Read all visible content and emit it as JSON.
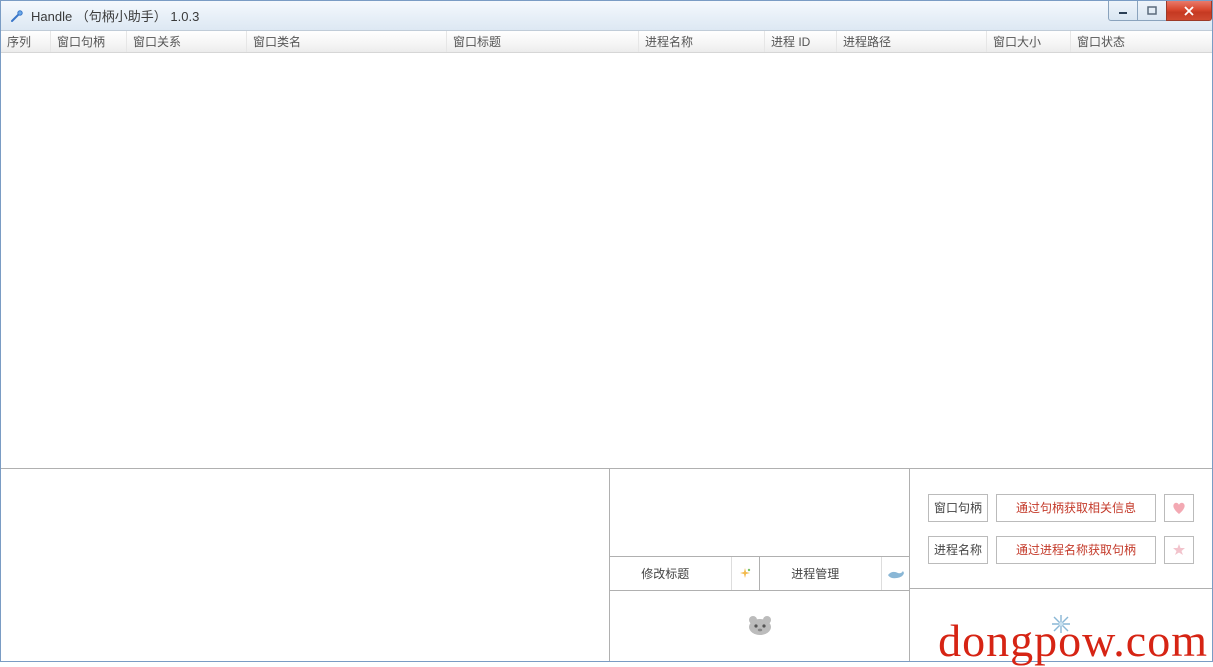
{
  "titlebar": {
    "title": "Handle （句柄小助手） 1.0.3"
  },
  "columns": [
    "序列",
    "窗口句柄",
    "窗口关系",
    "窗口类名",
    "窗口标题",
    "进程名称",
    "进程 ID",
    "进程路径",
    "窗口大小",
    "窗口状态"
  ],
  "bottom": {
    "modify_title": "修改标题",
    "process_mgmt": "进程管理",
    "search": {
      "handle_label": "窗口句柄",
      "handle_button": "通过句柄获取相关信息",
      "name_label": "进程名称",
      "name_button": "通过进程名称获取句柄"
    }
  },
  "watermark": "dongpow.com"
}
